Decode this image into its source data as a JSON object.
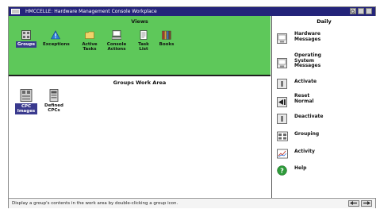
{
  "titlebar": {
    "title": "HMCCELLE: Hardware Management Console Workplace"
  },
  "views": {
    "title": "Views",
    "items": [
      {
        "label": "Groups",
        "icon": "groups-icon",
        "selected": true
      },
      {
        "label": "Exceptions",
        "icon": "exceptions-icon"
      },
      {
        "label": "Active Tasks",
        "icon": "folder-icon"
      },
      {
        "label": "Console Actions",
        "icon": "console-actions-icon"
      },
      {
        "label": "Task List",
        "icon": "task-list-icon"
      },
      {
        "label": "Books",
        "icon": "books-icon"
      }
    ]
  },
  "workarea": {
    "title": "Groups Work Area",
    "items": [
      {
        "label": "CPC Images",
        "icon": "cpc-images-icon",
        "selected": true
      },
      {
        "label": "Defined CPCs",
        "icon": "defined-cpcs-icon"
      }
    ]
  },
  "daily": {
    "title": "Daily",
    "tasks": [
      {
        "label": "Hardware Messages",
        "icon": "hardware-messages-icon"
      },
      {
        "label": "Operating System Messages",
        "icon": "os-messages-icon"
      },
      {
        "label": "Activate",
        "icon": "activate-icon"
      },
      {
        "label": "Reset Normal",
        "icon": "reset-normal-icon"
      },
      {
        "label": "Deactivate",
        "icon": "deactivate-icon"
      },
      {
        "label": "Grouping",
        "icon": "grouping-icon"
      },
      {
        "label": "Activity",
        "icon": "activity-icon"
      },
      {
        "label": "Help",
        "icon": "help-icon"
      }
    ]
  },
  "status": {
    "message": "Display a group's contents in the work area by double-clicking a group icon."
  },
  "colors": {
    "titlebar": "#24247a",
    "views_bg": "#5ec85a",
    "selection": "#3a3a8e"
  }
}
